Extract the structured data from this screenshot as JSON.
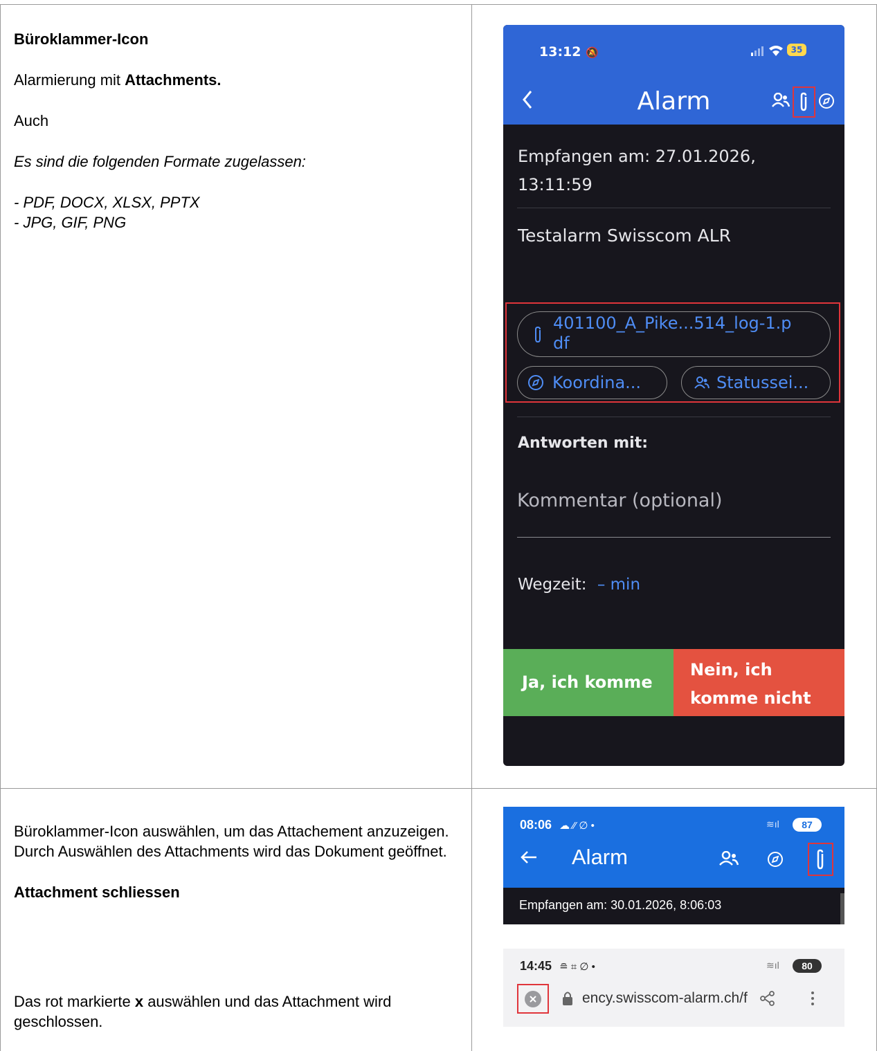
{
  "row1": {
    "heading": "Büroklammer-Icon",
    "line1_prefix": "Alarmierung mit ",
    "line1_bold": "Attachments.",
    "line2": "Auch",
    "formats_intro": "Es sind die folgenden Formate zugelassen:",
    "formats_1": "- PDF, DOCX, XLSX, PPTX",
    "formats_2": "- JPG, GIF, PNG"
  },
  "phone1": {
    "time": "13:12",
    "battery": "35",
    "title": "Alarm",
    "received_label": "Empfangen am: 27.01.2026,",
    "received_time": "13:11:59",
    "message": "Testalarm Swisscom ALR",
    "attachment_line1": "401100_A_Pike...514_log-1.p",
    "attachment_line2": "df",
    "chip_coords": "Koordina...",
    "chip_status": "Statussei...",
    "answer_label": "Antworten mit:",
    "comment_placeholder": "Kommentar (optional)",
    "travel_label": "Wegzeit:",
    "travel_value": "– min",
    "yes_button": "Ja, ich komme",
    "no_button_1": "Nein, ich",
    "no_button_2": "komme nicht",
    "colors": {
      "blue": "#2f66d6",
      "green": "#5aae58",
      "red": "#e45240",
      "dark": "#17161d"
    }
  },
  "row2": {
    "text1": "Büroklammer-Icon auswählen, um das Attachement anzuzeigen. Durch Auswählen des Attachments wird das Dokument geöffnet.",
    "heading2": "Attachment schliessen",
    "text2_prefix": "Das rot markierte ",
    "text2_bold": "x",
    "text2_suffix": " auswählen und das Attachment wird geschlossen."
  },
  "phone2": {
    "time": "08:06",
    "battery": "87",
    "title": "Alarm",
    "received": "Empfangen am: 30.01.2026, 8:06:03"
  },
  "phone3": {
    "time": "14:45",
    "battery": "80",
    "url": "ency.swisscom-alarm.ch/f"
  }
}
